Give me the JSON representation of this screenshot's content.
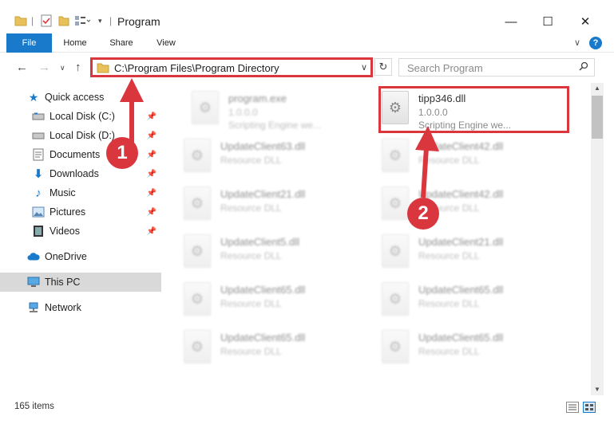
{
  "window": {
    "title": "Program",
    "minimize": "—",
    "maximize": "☐",
    "close": "✕"
  },
  "ribbon": {
    "tabs": [
      "File",
      "Home",
      "Share",
      "View"
    ],
    "collapse": "∨",
    "help": "?"
  },
  "address": {
    "path": "C:\\Program Files\\Program Directory",
    "dropdown": "∨",
    "refresh": "↻"
  },
  "search": {
    "placeholder": "Search Program",
    "icon": "search-icon"
  },
  "nav": {
    "items": [
      {
        "label": "Quick access",
        "icon": "star-icon"
      },
      {
        "label": "Local Disk (C:)",
        "icon": "drive-icon",
        "pinned": true
      },
      {
        "label": "Local Disk (D:)",
        "icon": "drive-icon",
        "pinned": true
      },
      {
        "label": "Documents",
        "icon": "documents-icon",
        "pinned": true
      },
      {
        "label": "Downloads",
        "icon": "download-icon",
        "pinned": true
      },
      {
        "label": "Music",
        "icon": "music-icon",
        "pinned": true
      },
      {
        "label": "Pictures",
        "icon": "pictures-icon",
        "pinned": true
      },
      {
        "label": "Videos",
        "icon": "videos-icon",
        "pinned": true
      },
      {
        "label": "OneDrive",
        "icon": "cloud-icon"
      },
      {
        "label": "This PC",
        "icon": "computer-icon",
        "selected": true
      },
      {
        "label": "Network",
        "icon": "network-icon"
      }
    ]
  },
  "files": {
    "left": [
      {
        "name": "program.exe",
        "version": "1.0.0.0",
        "desc": "Scripting Engine we..."
      },
      {
        "name": "UpdateClient63.dll",
        "desc": "Resource DLL"
      },
      {
        "name": "UpdateClient21.dll",
        "desc": "Resource DLL"
      },
      {
        "name": "UpdateClient5.dll",
        "desc": "Resource DLL"
      },
      {
        "name": "UpdateClient65.dll",
        "desc": "Resource DLL"
      },
      {
        "name": "UpdateClient65.dll",
        "desc": "Resource DLL"
      }
    ],
    "right": [
      {
        "name": "tipp346.dll",
        "version": "1.0.0.0",
        "desc": "Scripting Engine we...",
        "highlighted": true
      },
      {
        "name": "UpdateClient42.dll",
        "desc": "Resource DLL"
      },
      {
        "name": "UpdateClient42.dll",
        "desc": "Resource DLL"
      },
      {
        "name": "UpdateClient21.dll",
        "desc": "Resource DLL"
      },
      {
        "name": "UpdateClient65.dll",
        "desc": "Resource DLL"
      },
      {
        "name": "UpdateClient65.dll",
        "desc": "Resource DLL"
      }
    ]
  },
  "status": {
    "items": "165 items"
  },
  "annotations": {
    "badge1": "1",
    "badge2": "2",
    "color": "#d9363e"
  }
}
